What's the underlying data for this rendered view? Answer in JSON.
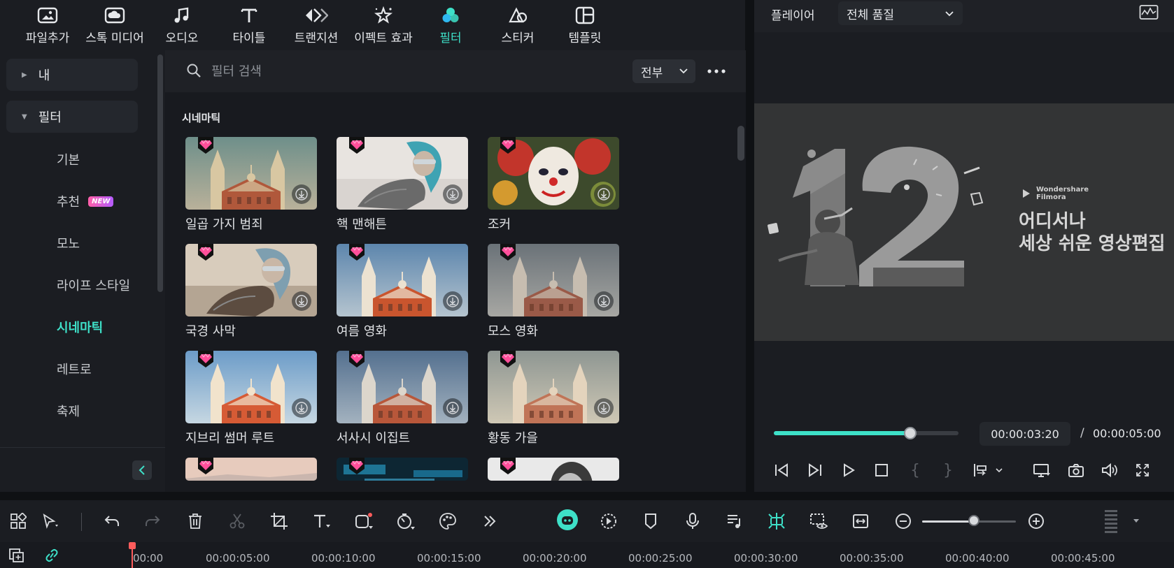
{
  "top_toolbar": {
    "items": [
      {
        "label": "파일추가",
        "icon": "import-media-icon"
      },
      {
        "label": "스톡 미디어",
        "icon": "stock-media-icon"
      },
      {
        "label": "오디오",
        "icon": "music-note-icon"
      },
      {
        "label": "타이틀",
        "icon": "title-text-icon"
      },
      {
        "label": "트랜지션",
        "icon": "transition-icon"
      },
      {
        "label": "이펙트 효과",
        "icon": "effects-star-icon"
      },
      {
        "label": "필터",
        "icon": "filter-icon",
        "active": true
      },
      {
        "label": "스티커",
        "icon": "sticker-icon"
      },
      {
        "label": "템플릿",
        "icon": "template-icon"
      }
    ]
  },
  "sidebar": {
    "groups": [
      {
        "label": "내",
        "expanded": false
      },
      {
        "label": "필터",
        "expanded": true
      }
    ],
    "items": [
      {
        "label": "기본"
      },
      {
        "label": "추천",
        "badge": "NEW"
      },
      {
        "label": "모노"
      },
      {
        "label": "라이프 스타일"
      },
      {
        "label": "시네마틱",
        "active": true
      },
      {
        "label": "레트로"
      },
      {
        "label": "축제"
      }
    ],
    "collapse_icon": "chevron-left-icon"
  },
  "search": {
    "placeholder": "필터 검색",
    "value": "",
    "filter_dropdown": "전부"
  },
  "filters_section": {
    "title": "시네마틱",
    "cards": [
      {
        "name": "일곱 가지 범죄",
        "art": "church-teal"
      },
      {
        "name": "핵 맨해튼",
        "art": "robot-light"
      },
      {
        "name": "조커",
        "art": "clown"
      },
      {
        "name": "국경 사막",
        "art": "robot-warm"
      },
      {
        "name": "여름 영화",
        "art": "church-blue"
      },
      {
        "name": "모스 영화",
        "art": "church-grey"
      },
      {
        "name": "지브리 썸머 루트",
        "art": "church-bright"
      },
      {
        "name": "서사시 이집트",
        "art": "church-cool"
      },
      {
        "name": "황동 가을",
        "art": "church-faded"
      },
      {
        "name": "",
        "art": "peach"
      },
      {
        "name": "",
        "art": "cyber"
      },
      {
        "name": "",
        "art": "portrait-bw"
      }
    ]
  },
  "player": {
    "title": "플레이어",
    "quality": "전체 품질",
    "promo": {
      "brand_line1": "Wondershare",
      "brand_line2": "Filmora",
      "line1": "어디서나",
      "line2": "세상 쉬운 영상편집",
      "big_number": "12"
    },
    "progress_fraction": 0.74,
    "current_time": "00:00:03:20",
    "separator": "/",
    "total_time": "00:00:05:00"
  },
  "timeline": {
    "zoom_fraction": 0.55,
    "ruler": [
      "00:00",
      "00:00:05:00",
      "00:00:10:00",
      "00:00:15:00",
      "00:00:20:00",
      "00:00:25:00",
      "00:00:30:00",
      "00:00:35:00",
      "00:00:40:00",
      "00:00:45:00"
    ]
  },
  "colors": {
    "accent": "#3ee0c8",
    "badge_pink": "#ff5fa8",
    "playhead": "#ff5c5c"
  }
}
